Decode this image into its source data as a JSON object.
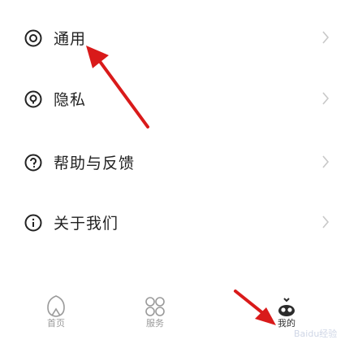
{
  "settings_menu": {
    "items": [
      {
        "label": "通用",
        "icon": "settings-gear-icon"
      },
      {
        "label": "隐私",
        "icon": "privacy-shield-icon"
      },
      {
        "label": "帮助与反馈",
        "icon": "help-question-icon"
      },
      {
        "label": "关于我们",
        "icon": "info-icon"
      }
    ]
  },
  "bottom_tabs": [
    {
      "label": "首页",
      "icon": "home-icon"
    },
    {
      "label": "服务",
      "icon": "grid-services-icon"
    },
    {
      "label": "我的",
      "icon": "profile-icon"
    }
  ],
  "side_label": "我的",
  "watermark": "Baidu经验",
  "annotation_colors": {
    "arrow": "#d91a1a"
  }
}
